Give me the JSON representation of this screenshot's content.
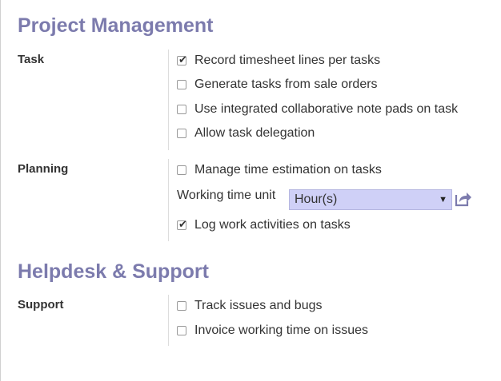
{
  "sections": [
    {
      "title": "Project Management",
      "groups": [
        {
          "label": "Task",
          "options": [
            {
              "label": "Record timesheet lines per tasks",
              "checked": true
            },
            {
              "label": "Generate tasks from sale orders",
              "checked": false
            },
            {
              "label": "Use integrated collaborative note pads on task",
              "checked": false
            },
            {
              "label": "Allow task delegation",
              "checked": false
            }
          ]
        },
        {
          "label": "Planning",
          "options": [
            {
              "label": "Manage time estimation on tasks",
              "checked": false
            },
            {
              "label": "Log work activities on tasks",
              "checked": true
            }
          ],
          "working_time_unit": {
            "label": "Working time unit",
            "value": "Hour(s)"
          }
        }
      ]
    },
    {
      "title": "Helpdesk & Support",
      "groups": [
        {
          "label": "Support",
          "options": [
            {
              "label": "Track issues and bugs",
              "checked": false
            },
            {
              "label": "Invoice working time on issues",
              "checked": false
            }
          ]
        }
      ]
    }
  ],
  "colors": {
    "section_title": "#7c7bad",
    "select_background": "#cfd0f7",
    "link_icon": "#7c7bad"
  },
  "icons": {
    "checkmark": "✔",
    "select_caret": "▼",
    "external_link": "external-link-icon"
  }
}
